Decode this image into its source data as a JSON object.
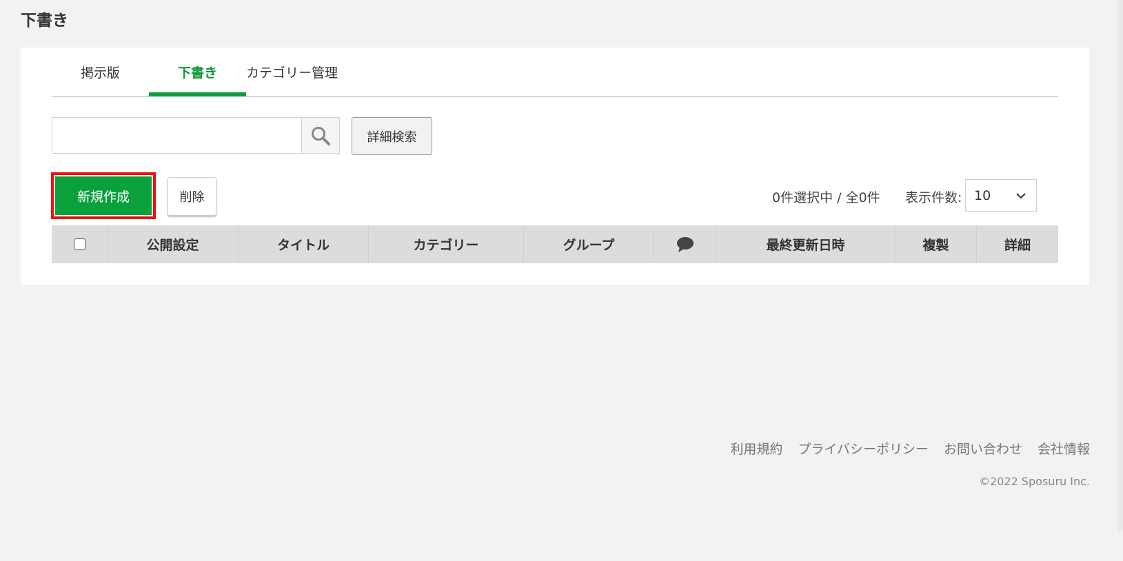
{
  "page_title": "下書き",
  "tabs": [
    {
      "label": "掲示版"
    },
    {
      "label": "下書き",
      "active": true
    },
    {
      "label": "カテゴリー管理"
    }
  ],
  "search": {
    "value": "",
    "placeholder": ""
  },
  "toolbar": {
    "advanced_search_label": "詳細検索",
    "new_label": "新規作成",
    "delete_label": "削除",
    "selection_count": "0件選択中 / 全0件",
    "per_page_label": "表示件数:",
    "per_page_value": "10"
  },
  "table": {
    "columns": [
      "公開設定",
      "タイトル",
      "カテゴリー",
      "グループ",
      "最終更新日時",
      "複製",
      "詳細"
    ]
  },
  "icons": {
    "search": "search-icon",
    "comment": "comment-icon",
    "select": "chevron-down-icon"
  },
  "colors": {
    "accent": "#0aa03c",
    "highlight": "#ee1111",
    "header_bg": "#dcdcdc"
  },
  "footer": {
    "links": [
      "利用規約",
      "プライバシーポリシー",
      "お問い合わせ",
      "会社情報"
    ],
    "copyright": "©2022 Sposuru Inc."
  }
}
